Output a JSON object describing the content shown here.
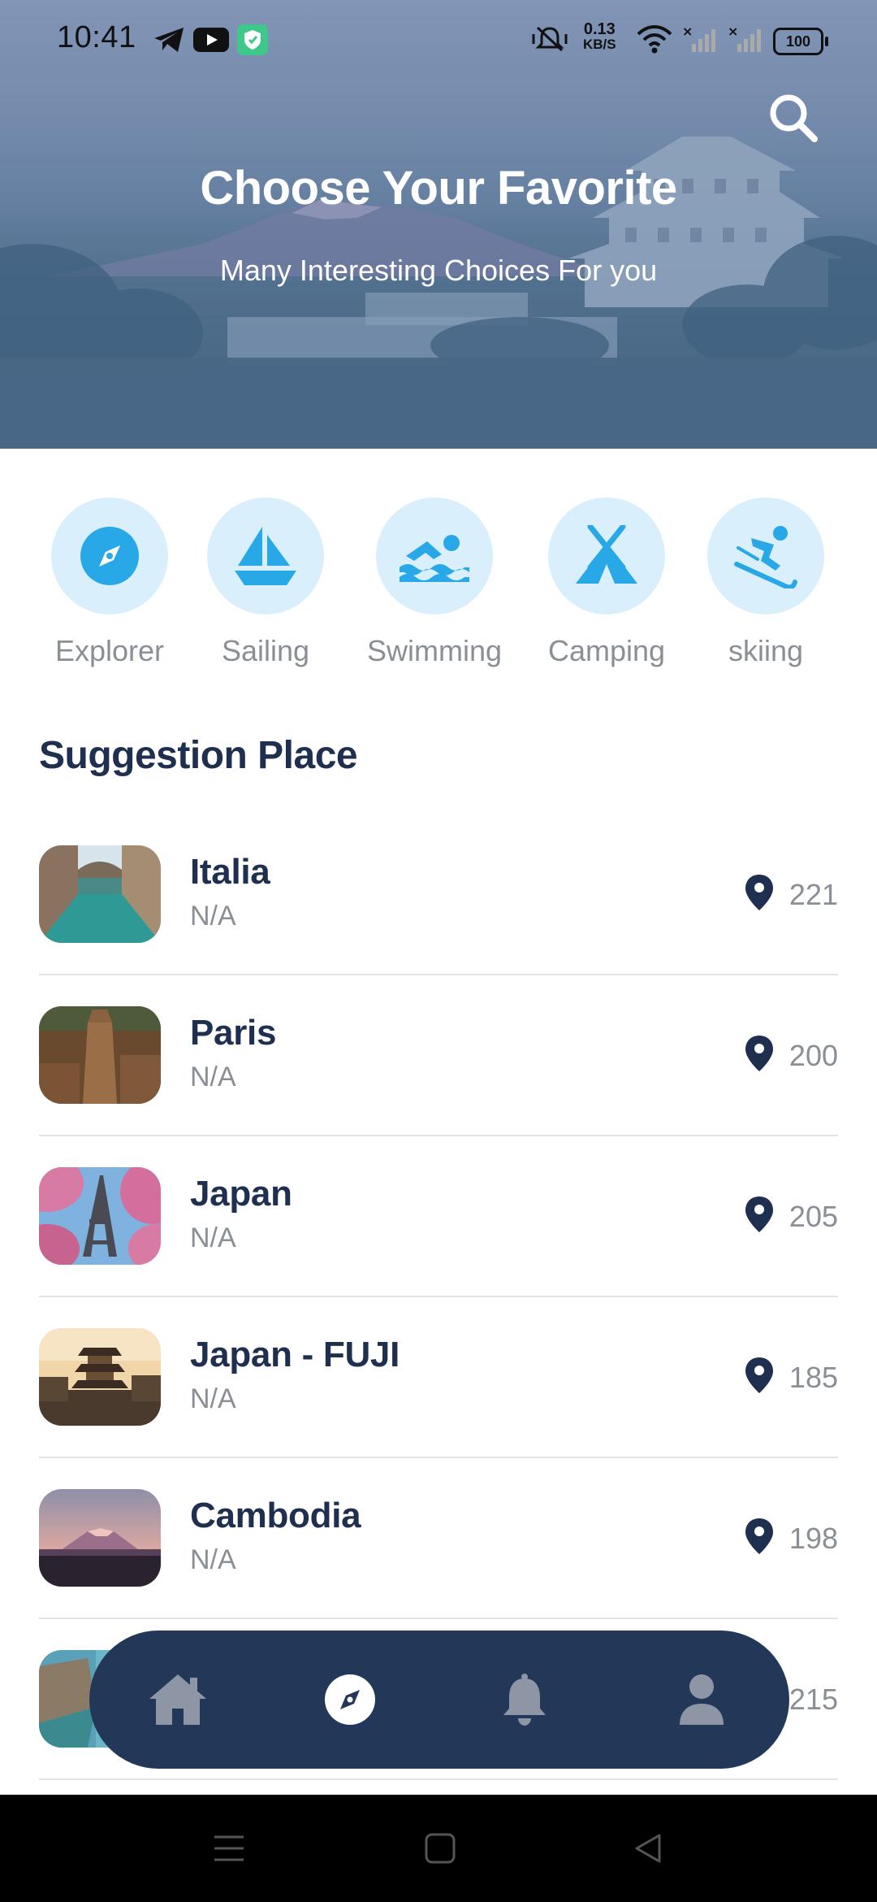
{
  "status_bar": {
    "time": "10:41",
    "net_speed_value": "0.13",
    "net_speed_unit": "KB/S",
    "battery": "100"
  },
  "hero": {
    "title": "Choose Your Favorite",
    "subtitle": "Many Interesting Choices For you"
  },
  "categories": [
    {
      "label": "Explorer",
      "icon": "compass-icon"
    },
    {
      "label": "Sailing",
      "icon": "sailboat-icon"
    },
    {
      "label": "Swimming",
      "icon": "swimmer-icon"
    },
    {
      "label": "Camping",
      "icon": "tent-icon"
    },
    {
      "label": "skiing",
      "icon": "skier-icon"
    }
  ],
  "section_title": "Suggestion Place",
  "places": [
    {
      "name": "Italia",
      "sub": "N/A",
      "count": "221"
    },
    {
      "name": "Paris",
      "sub": "N/A",
      "count": "200"
    },
    {
      "name": "Japan",
      "sub": "N/A",
      "count": "205"
    },
    {
      "name": "Japan - FUJI",
      "sub": "N/A",
      "count": "185"
    },
    {
      "name": "Cambodia",
      "sub": "N/A",
      "count": "198"
    },
    {
      "name": "",
      "sub": "",
      "count": "215"
    }
  ],
  "bottom_nav": [
    {
      "name": "home",
      "icon": "home-icon",
      "active": false
    },
    {
      "name": "explore",
      "icon": "compass-icon",
      "active": true
    },
    {
      "name": "notifications",
      "icon": "bell-icon",
      "active": false
    },
    {
      "name": "profile",
      "icon": "user-icon",
      "active": false
    }
  ],
  "colors": {
    "primary": "#1e2f50",
    "nav_bg": "#233759",
    "category_bg": "#d9effc",
    "category_icon": "#29a8e8",
    "muted_text": "#8a8f96"
  }
}
